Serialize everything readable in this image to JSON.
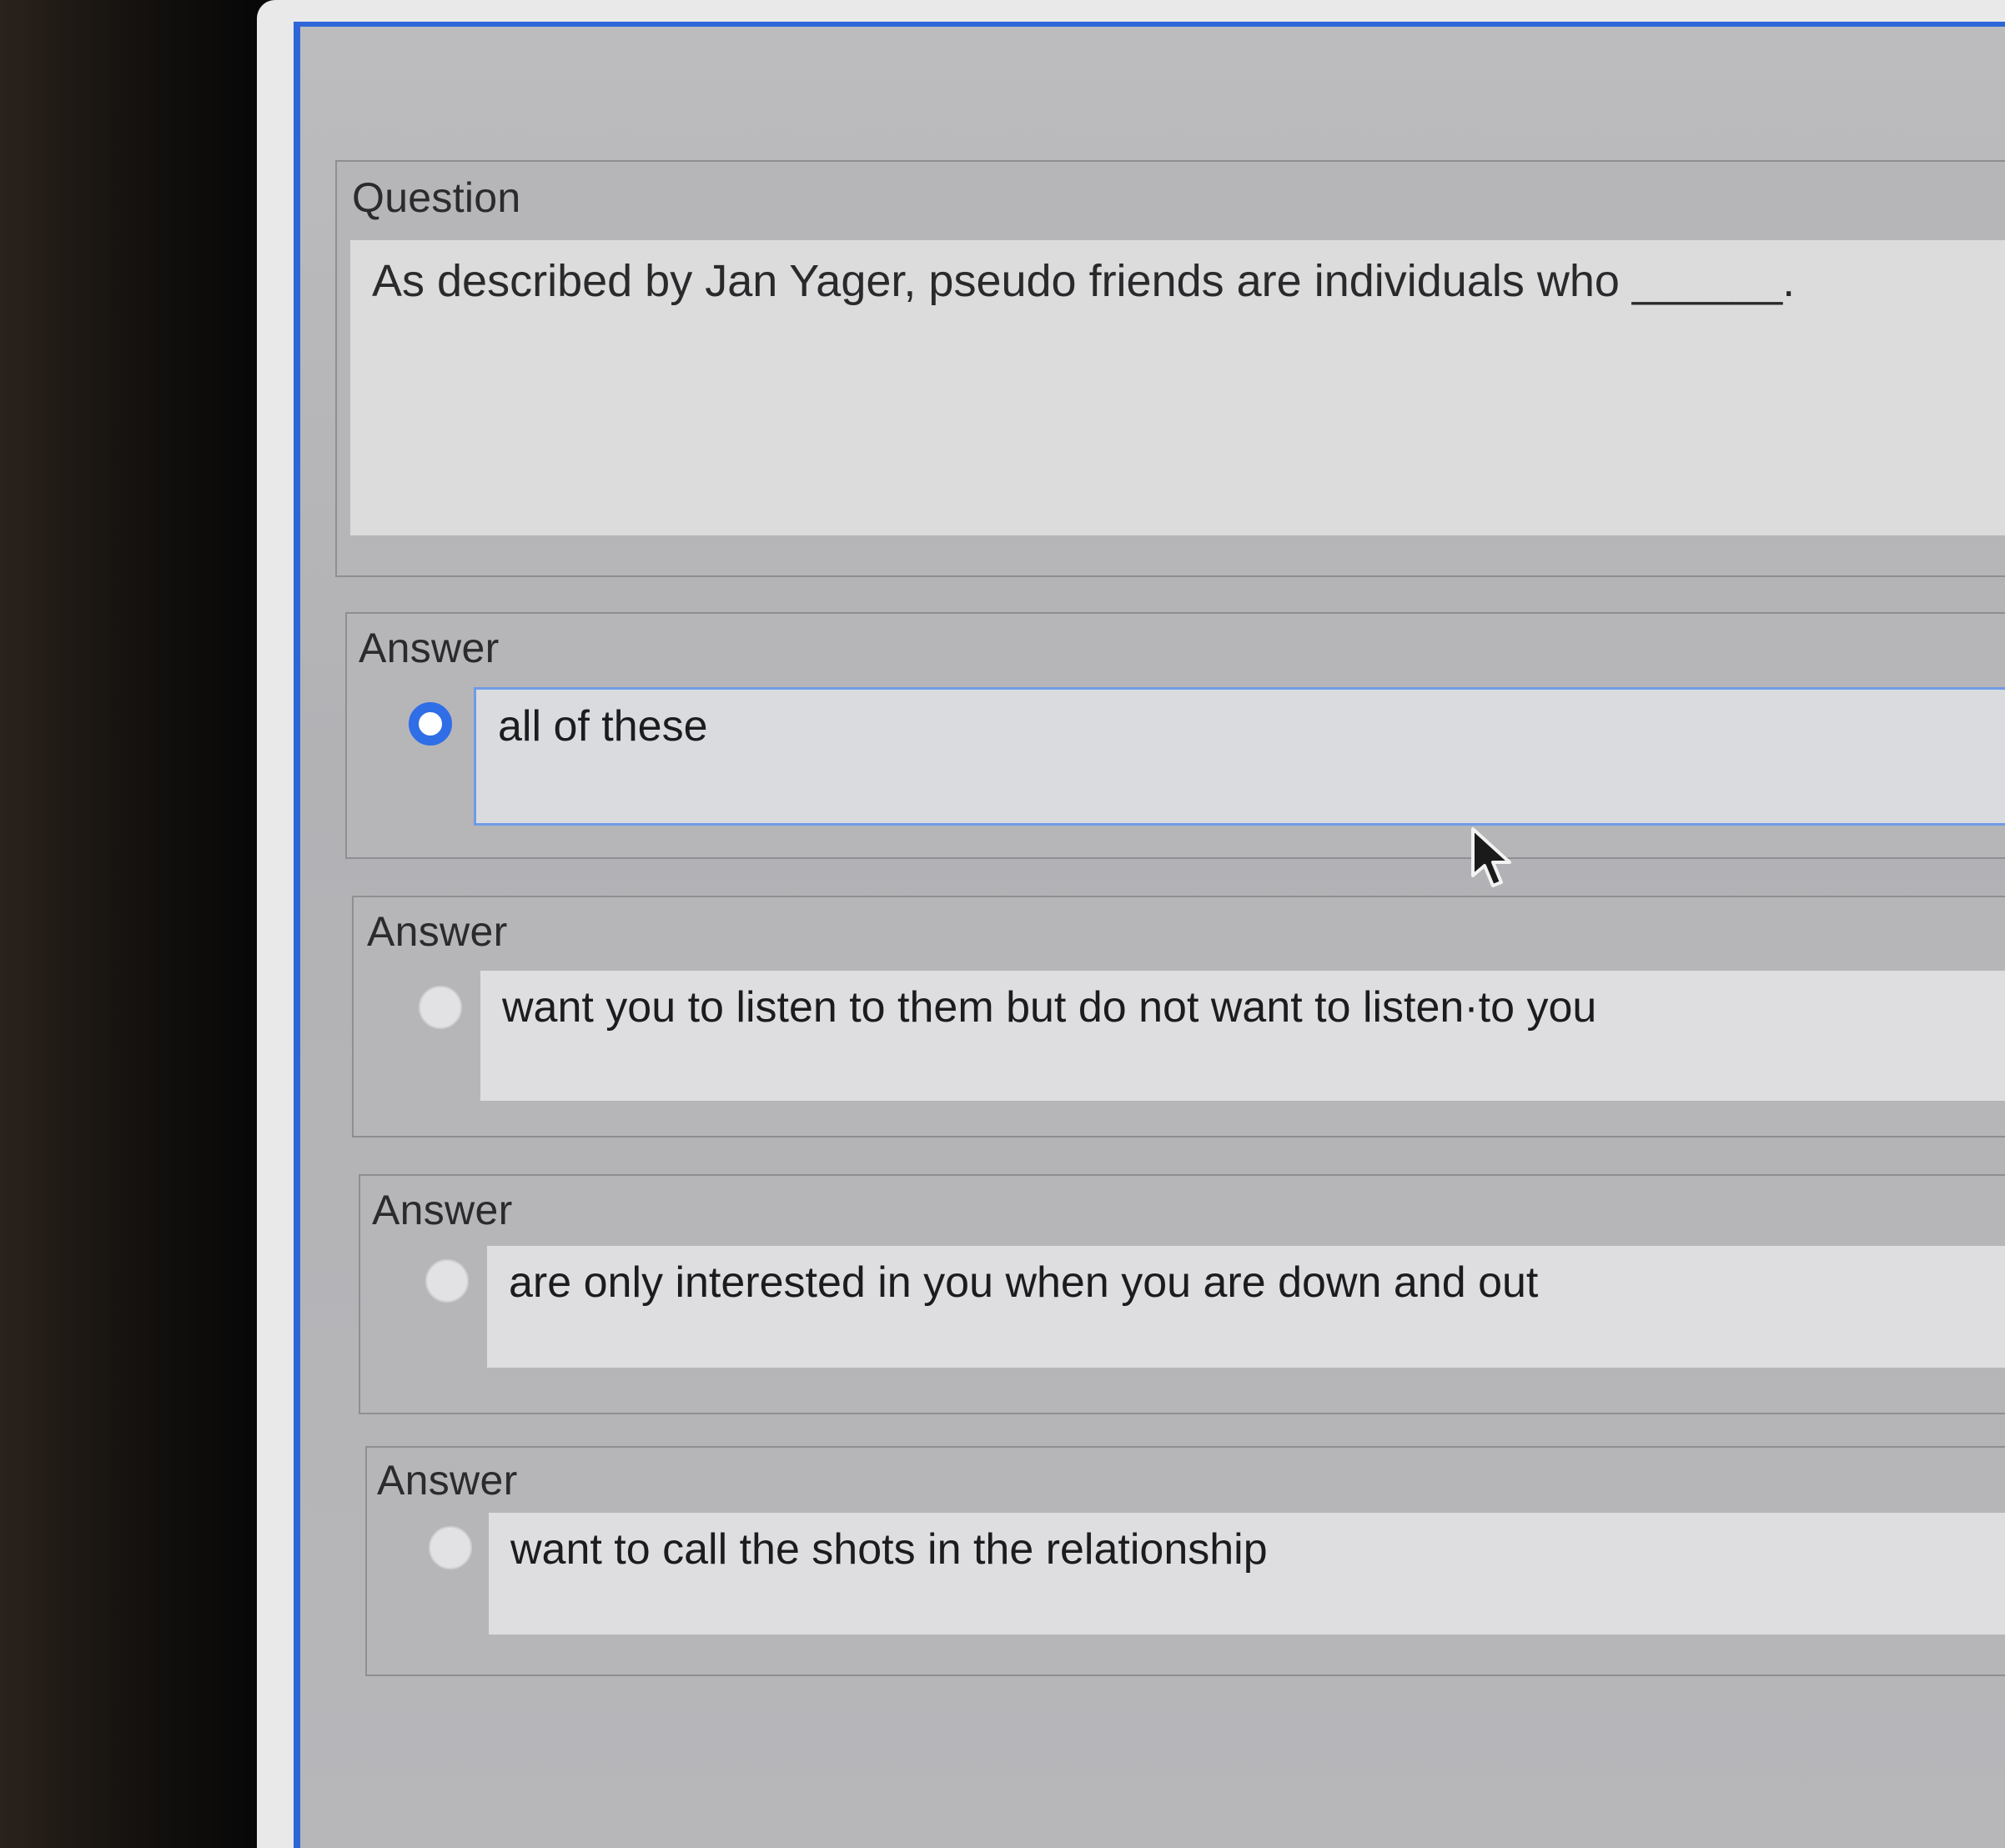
{
  "question": {
    "label": "Question",
    "text": "As described by Jan Yager, pseudo friends are individuals who ______."
  },
  "answers": [
    {
      "label": "Answer",
      "text": "all of these",
      "selected": true
    },
    {
      "label": "Answer",
      "text": "want you to listen to them but do not want to listen·to you",
      "selected": false
    },
    {
      "label": "Answer",
      "text": "are only interested in you when you are down and out",
      "selected": false
    },
    {
      "label": "Answer",
      "text": "want to call the shots in the relationship",
      "selected": false
    }
  ],
  "colors": {
    "accent": "#2f6ee6",
    "screen_border": "#2e66d8"
  },
  "icons": {
    "cursor": "mouse-pointer-icon",
    "radio_checked": "radio-checked-icon",
    "radio_unchecked": "radio-unchecked-icon"
  }
}
